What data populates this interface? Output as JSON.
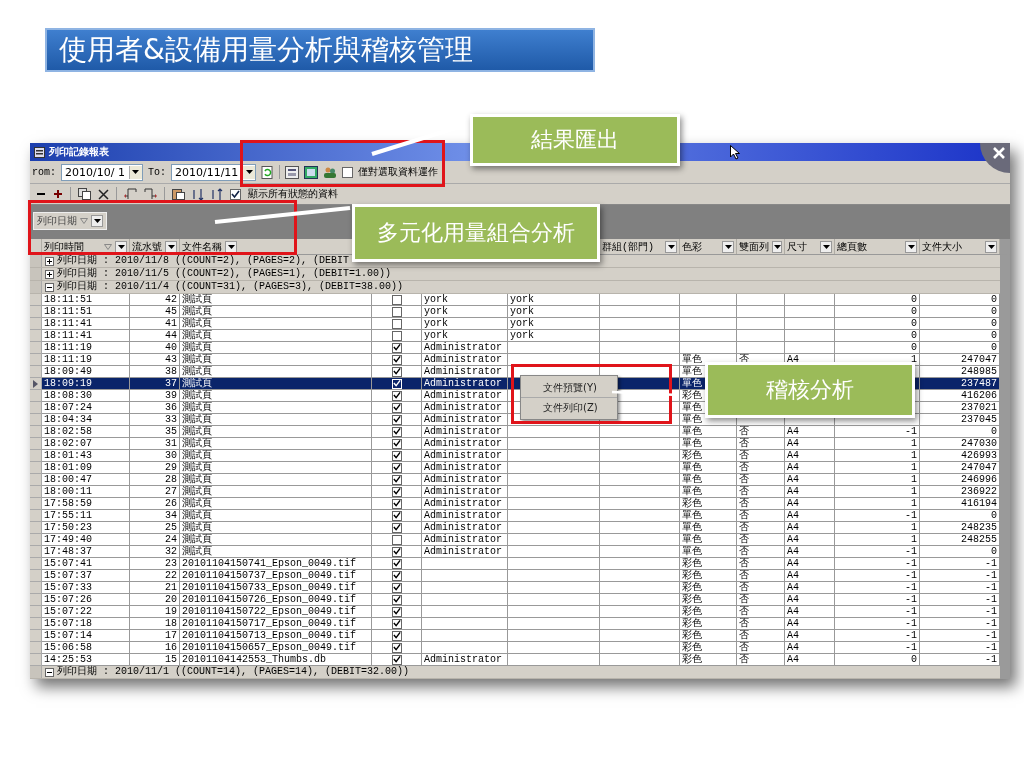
{
  "slide_title": "使用者&設備用量分析與稽核管理",
  "window": {
    "title": "列印記錄報表"
  },
  "toolbar": {
    "from_label": "rom:",
    "from_value": "2010/10/ 1",
    "to_label": "To:",
    "to_value": "2010/11/11",
    "selected_only": {
      "label": "僅對選取資料運作",
      "checked": false
    }
  },
  "toolbar2": {
    "show_all": {
      "label": "顯示所有狀態的資料",
      "checked": true
    }
  },
  "group_panel": {
    "chips": [
      {
        "label": "列印日期"
      }
    ]
  },
  "table": {
    "columns_left": [
      {
        "label": "列印時間"
      },
      {
        "label": "流水號"
      },
      {
        "label": "文件名稱"
      }
    ],
    "columns_right": [
      {
        "label": "群組(部門)"
      },
      {
        "label": "色彩"
      },
      {
        "label": "雙面列"
      },
      {
        "label": "尺寸"
      },
      {
        "label": "總頁數"
      },
      {
        "label": "文件大小"
      }
    ],
    "groups_before": [
      {
        "text": "列印日期 : 2010/11/8 ((COUNT=2), (PAGES=2), (DEBIT",
        "expanded": false
      },
      {
        "text": "列印日期 : 2010/11/5 ((COUNT=2), (PAGES=1), (DEBIT=1.00))",
        "expanded": false
      },
      {
        "text": "列印日期 : 2010/11/4 ((COUNT=31), (PAGES=3), (DEBIT=38.00))",
        "expanded": true
      }
    ],
    "rows": [
      {
        "time": "18:11:51",
        "serial": "42",
        "name": "測試頁",
        "checked": false,
        "column_5": "york",
        "column_6": "york",
        "pages": "0",
        "file_size": "0",
        "selected": false
      },
      {
        "time": "18:11:51",
        "serial": "45",
        "name": "測試頁",
        "checked": false,
        "column_5": "york",
        "column_6": "york",
        "pages": "0",
        "file_size": "0",
        "selected": false
      },
      {
        "time": "18:11:41",
        "serial": "41",
        "name": "測試頁",
        "checked": false,
        "column_5": "york",
        "column_6": "york",
        "pages": "0",
        "file_size": "0",
        "selected": false
      },
      {
        "time": "18:11:41",
        "serial": "44",
        "name": "測試頁",
        "checked": false,
        "column_5": "york",
        "column_6": "york",
        "pages": "0",
        "file_size": "0",
        "selected": false
      },
      {
        "time": "18:11:19",
        "serial": "40",
        "name": "測試頁",
        "checked": true,
        "column_5": "Administrator",
        "pages": "0",
        "file_size": "0",
        "selected": false
      },
      {
        "time": "18:11:19",
        "serial": "43",
        "name": "測試頁",
        "checked": true,
        "column_5": "Administrator",
        "color_mode": "單色",
        "duplex": "否",
        "size": "A4",
        "pages": "1",
        "file_size": "247047",
        "selected": false
      },
      {
        "time": "18:09:49",
        "serial": "38",
        "name": "測試頁",
        "checked": true,
        "column_5": "Administrator",
        "color_mode": "單色",
        "file_size": "248985",
        "selected": false
      },
      {
        "time": "18:09:19",
        "serial": "37",
        "name": "測試頁",
        "checked": true,
        "column_5": "Administrator",
        "color_mode": "單色",
        "file_size": "237487",
        "selected": true
      },
      {
        "time": "18:08:30",
        "serial": "39",
        "name": "測試頁",
        "checked": true,
        "column_5": "Administrator",
        "color_mode": "彩色",
        "file_size": "416206",
        "selected": false
      },
      {
        "time": "18:07:24",
        "serial": "36",
        "name": "測試頁",
        "checked": true,
        "column_5": "Administrator",
        "color_mode": "單色",
        "file_size": "237021",
        "selected": false
      },
      {
        "time": "18:04:34",
        "serial": "33",
        "name": "測試頁",
        "checked": true,
        "column_5": "Administrator",
        "color_mode": "單色",
        "file_size": "237045",
        "selected": false
      },
      {
        "time": "18:02:58",
        "serial": "35",
        "name": "測試頁",
        "checked": true,
        "column_5": "Administrator",
        "color_mode": "單色",
        "duplex": "否",
        "size": "A4",
        "pages": "-1",
        "file_size": "0",
        "selected": false
      },
      {
        "time": "18:02:07",
        "serial": "31",
        "name": "測試頁",
        "checked": true,
        "column_5": "Administrator",
        "color_mode": "單色",
        "duplex": "否",
        "size": "A4",
        "pages": "1",
        "file_size": "247030",
        "selected": false
      },
      {
        "time": "18:01:43",
        "serial": "30",
        "name": "測試頁",
        "checked": true,
        "column_5": "Administrator",
        "color_mode": "彩色",
        "duplex": "否",
        "size": "A4",
        "pages": "1",
        "file_size": "426993",
        "selected": false
      },
      {
        "time": "18:01:09",
        "serial": "29",
        "name": "測試頁",
        "checked": true,
        "column_5": "Administrator",
        "color_mode": "單色",
        "duplex": "否",
        "size": "A4",
        "pages": "1",
        "file_size": "247047",
        "selected": false
      },
      {
        "time": "18:00:47",
        "serial": "28",
        "name": "測試頁",
        "checked": true,
        "column_5": "Administrator",
        "color_mode": "單色",
        "duplex": "否",
        "size": "A4",
        "pages": "1",
        "file_size": "246996",
        "selected": false
      },
      {
        "time": "18:00:11",
        "serial": "27",
        "name": "測試頁",
        "checked": true,
        "column_5": "Administrator",
        "color_mode": "單色",
        "duplex": "否",
        "size": "A4",
        "pages": "1",
        "file_size": "236922",
        "selected": false
      },
      {
        "time": "17:58:59",
        "serial": "26",
        "name": "測試頁",
        "checked": true,
        "column_5": "Administrator",
        "color_mode": "彩色",
        "duplex": "否",
        "size": "A4",
        "pages": "1",
        "file_size": "416194",
        "selected": false
      },
      {
        "time": "17:55:11",
        "serial": "34",
        "name": "測試頁",
        "checked": true,
        "column_5": "Administrator",
        "color_mode": "單色",
        "duplex": "否",
        "size": "A4",
        "pages": "-1",
        "file_size": "0",
        "selected": false
      },
      {
        "time": "17:50:23",
        "serial": "25",
        "name": "測試頁",
        "checked": true,
        "column_5": "Administrator",
        "color_mode": "單色",
        "duplex": "否",
        "size": "A4",
        "pages": "1",
        "file_size": "248235",
        "selected": false
      },
      {
        "time": "17:49:40",
        "serial": "24",
        "name": "測試頁",
        "checked": false,
        "column_5": "Administrator",
        "color_mode": "單色",
        "duplex": "否",
        "size": "A4",
        "pages": "1",
        "file_size": "248255",
        "selected": false
      },
      {
        "time": "17:48:37",
        "serial": "32",
        "name": "測試頁",
        "checked": true,
        "column_5": "Administrator",
        "color_mode": "單色",
        "duplex": "否",
        "size": "A4",
        "pages": "-1",
        "file_size": "0",
        "selected": false
      },
      {
        "time": "15:07:41",
        "serial": "23",
        "name": "20101104150741_Epson_0049.tif",
        "checked": true,
        "color_mode": "彩色",
        "duplex": "否",
        "size": "A4",
        "pages": "-1",
        "file_size": "-1",
        "selected": false
      },
      {
        "time": "15:07:37",
        "serial": "22",
        "name": "20101104150737_Epson_0049.tif",
        "checked": true,
        "color_mode": "彩色",
        "duplex": "否",
        "size": "A4",
        "pages": "-1",
        "file_size": "-1",
        "selected": false
      },
      {
        "time": "15:07:33",
        "serial": "21",
        "name": "20101104150733_Epson_0049.tif",
        "checked": true,
        "color_mode": "彩色",
        "duplex": "否",
        "size": "A4",
        "pages": "-1",
        "file_size": "-1",
        "selected": false
      },
      {
        "time": "15:07:26",
        "serial": "20",
        "name": "20101104150726_Epson_0049.tif",
        "checked": true,
        "color_mode": "彩色",
        "duplex": "否",
        "size": "A4",
        "pages": "-1",
        "file_size": "-1",
        "selected": false
      },
      {
        "time": "15:07:22",
        "serial": "19",
        "name": "20101104150722_Epson_0049.tif",
        "checked": true,
        "color_mode": "彩色",
        "duplex": "否",
        "size": "A4",
        "pages": "-1",
        "file_size": "-1",
        "selected": false
      },
      {
        "time": "15:07:18",
        "serial": "18",
        "name": "20101104150717_Epson_0049.tif",
        "checked": true,
        "color_mode": "彩色",
        "duplex": "否",
        "size": "A4",
        "pages": "-1",
        "file_size": "-1",
        "selected": false
      },
      {
        "time": "15:07:14",
        "serial": "17",
        "name": "20101104150713_Epson_0049.tif",
        "checked": true,
        "color_mode": "彩色",
        "duplex": "否",
        "size": "A4",
        "pages": "-1",
        "file_size": "-1",
        "selected": false
      },
      {
        "time": "15:06:58",
        "serial": "16",
        "name": "20101104150657_Epson_0049.tif",
        "checked": true,
        "color_mode": "彩色",
        "duplex": "否",
        "size": "A4",
        "pages": "-1",
        "file_size": "-1",
        "selected": false
      },
      {
        "time": "14:25:53",
        "serial": "15",
        "name": "20101104142553_Thumbs.db",
        "checked": true,
        "column_5": "Administrator",
        "color_mode": "彩色",
        "duplex": "否",
        "size": "A4",
        "pages": "0",
        "file_size": "-1",
        "selected": false
      }
    ],
    "groups_after": [
      {
        "text": "列印日期 : 2010/11/1 ((COUNT=14), (PAGES=14), (DEBIT=32.00))",
        "expanded": true
      }
    ]
  },
  "context_menu": {
    "items": [
      {
        "label": "文件預覽(Y)"
      },
      {
        "label": "文件列印(Z)"
      }
    ]
  },
  "callouts": [
    {
      "text": "結果匯出"
    },
    {
      "text": "多元化用量組合分析"
    },
    {
      "text": "稽核分析"
    }
  ]
}
